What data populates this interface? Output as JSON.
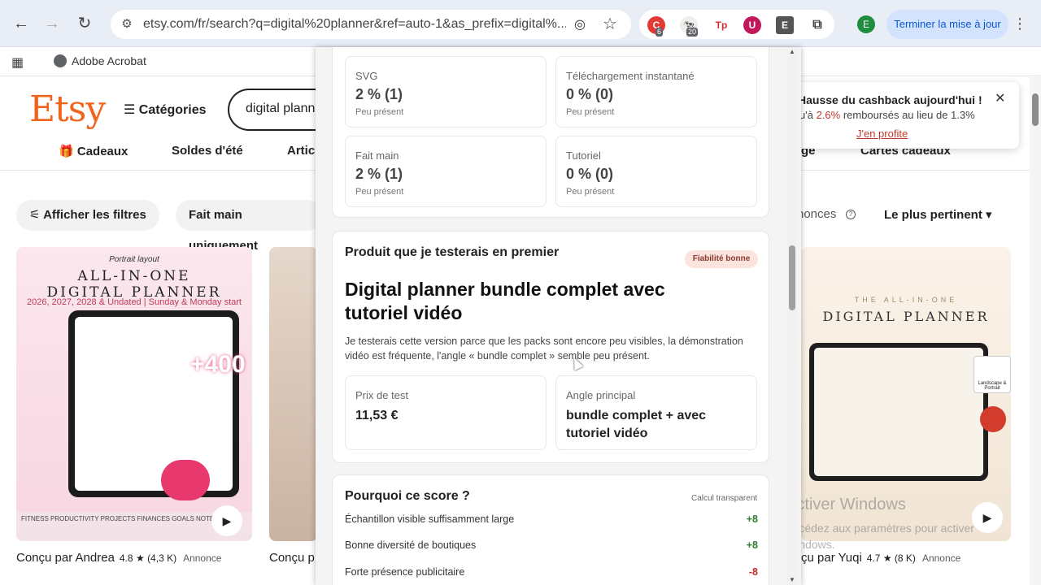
{
  "browser": {
    "url": "etsy.com/fr/search?q=digital%20planner&ref=auto-1&as_prefix=digital%...",
    "update_label": "Terminer la mise à jour",
    "profile_initial": "E",
    "bookmarks": [
      {
        "label": "Adobe Acrobat"
      }
    ],
    "extensions": [
      {
        "name": "red-c-extension",
        "badge": "6"
      },
      {
        "name": "cow-extension",
        "badge": "20"
      },
      {
        "name": "tp-extension",
        "label": "Tp"
      },
      {
        "name": "u-shield-extension",
        "label": "U"
      },
      {
        "name": "e-extension",
        "label": "E"
      },
      {
        "name": "puzzle-extension"
      }
    ]
  },
  "etsy": {
    "logo": "Etsy",
    "categories_label": "Catégories",
    "search_value": "digital plann",
    "nav": [
      "Cadeaux",
      "Soldes d'été",
      "Artic",
      "ge",
      "Cartes cadeaux"
    ],
    "filters": {
      "show_filters": "Afficher les filtres",
      "handmade_only": "Fait main uniquement",
      "ads_label": "nonces",
      "sort": "Le plus pertinent"
    },
    "promo": {
      "title": "Hausse du cashback aujourd'hui !",
      "line_prefix": "u'à ",
      "pct_new": "2.6%",
      "line_suffix": " remboursés au lieu de 1.3%",
      "cta": "J'en profite"
    },
    "products": [
      {
        "seller": "Conçu par Andrea",
        "rating": "4.8",
        "reviews": "(4,3 K)",
        "ad": "Annonce",
        "image_texts": {
          "tag": "Portrait layout",
          "title_line1": "ALL-IN-ONE",
          "title_line2": "DIGITAL PLANNER",
          "subtitle": "2026, 2027, 2028 & Undated | Sunday & Monday start",
          "badge": "+400",
          "strip": "FITNESS   PRODUCTIVITY   PROJECTS   FINANCES   GOALS   NOTEBOOKS"
        }
      },
      {
        "seller": "Conçu p"
      },
      {
        "seller": "çu par Yuqi",
        "rating": "4.7",
        "reviews": "(8 K)",
        "ad": "Annonce",
        "image_texts": {
          "title_line1": "THE ALL-IN-ONE",
          "title_line2": "DIGITAL PLANNER",
          "side_label": "Landscape & Portrait"
        }
      }
    ]
  },
  "watermark": {
    "title": "Activer Windows",
    "subtitle": "Accédez aux paramètres pour activer Windows."
  },
  "panel": {
    "stats": [
      {
        "label": "SVG",
        "value": "2 % (1)",
        "note": "Peu présent"
      },
      {
        "label": "Téléchargement instantané",
        "value": "0 % (0)",
        "note": "Peu présent"
      },
      {
        "label": "Fait main",
        "value": "2 % (1)",
        "note": "Peu présent"
      },
      {
        "label": "Tutoriel",
        "value": "0 % (0)",
        "note": "Peu présent"
      }
    ],
    "test_section": {
      "heading": "Produit que je testerais en premier",
      "reliability": "Fiabilité bonne",
      "product_title": "Digital planner bundle complet avec tutoriel vidéo",
      "description": "Je testerais cette version parce que les packs sont encore peu visibles, la démonstration vidéo est fréquente, l'angle « bundle complet » semble peu présent.",
      "price_label": "Prix de test",
      "price_value": "11,53 €",
      "angle_label": "Angle principal",
      "angle_value": "bundle complet + avec tutoriel vidéo"
    },
    "score_section": {
      "heading": "Pourquoi ce score ?",
      "note": "Calcul transparent",
      "rows": [
        {
          "label": "Échantillon visible suffisamment large",
          "points": "+8"
        },
        {
          "label": "Bonne diversité de boutiques",
          "points": "+8"
        },
        {
          "label": "Forte présence publicitaire",
          "points": "-8"
        }
      ]
    }
  },
  "colors": {
    "etsy_orange": "#f1641e",
    "positive": "#2e7d32",
    "negative": "#c62828",
    "reliability_bg": "#fbe3de"
  }
}
